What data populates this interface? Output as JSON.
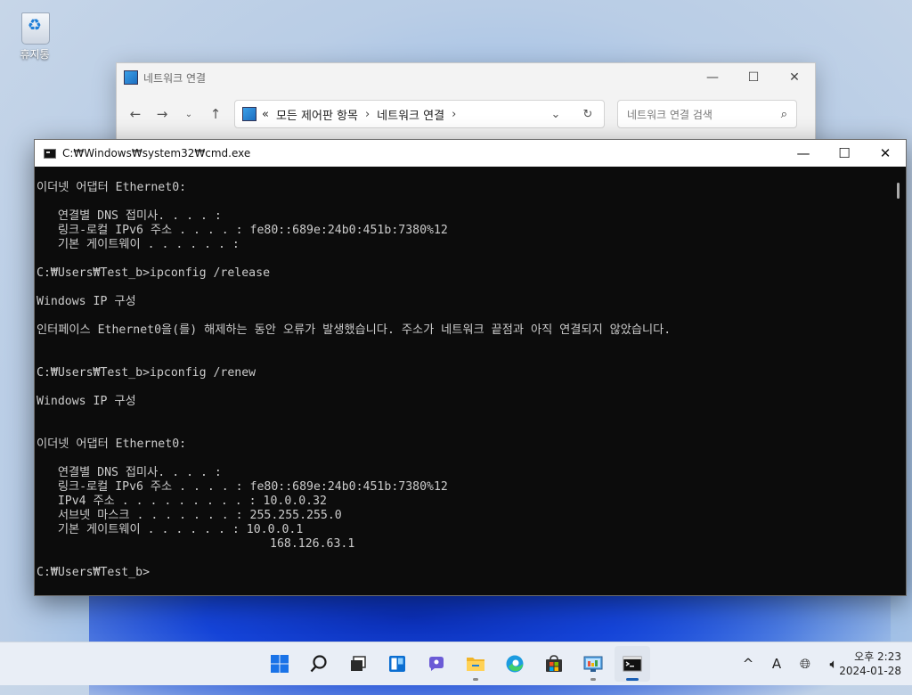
{
  "desktop": {
    "recycle_bin_label": "휴지통"
  },
  "explorer": {
    "title": "네트워크 연결",
    "breadcrumb_overflow": "«",
    "breadcrumb": [
      "모든 제어판 항목",
      "네트워크 연결"
    ],
    "search_placeholder": "네트워크 연결 검색"
  },
  "cmd": {
    "title": "C:₩Windows₩system32₩cmd.exe",
    "lines": [
      "",
      "이더넷 어댑터 Ethernet0:",
      "",
      "   연결별 DNS 접미사. . . . :",
      "   링크-로컬 IPv6 주소 . . . . : fe80::689e:24b0:451b:7380%12",
      "   기본 게이트웨이 . . . . . . :",
      "",
      "C:₩Users₩Test_b>ipconfig /release",
      "",
      "Windows IP 구성",
      "",
      "인터페이스 Ethernet0을(를) 해제하는 동안 오류가 발생했습니다. 주소가 네트워크 끝점과 아직 연결되지 않았습니다.",
      "",
      "",
      "C:₩Users₩Test_b>ipconfig /renew",
      "",
      "Windows IP 구성",
      "",
      "",
      "이더넷 어댑터 Ethernet0:",
      "",
      "   연결별 DNS 접미사. . . . :",
      "   링크-로컬 IPv6 주소 . . . . : fe80::689e:24b0:451b:7380%12",
      "   IPv4 주소 . . . . . . . . . : 10.0.0.32",
      "   서브넷 마스크 . . . . . . . : 255.255.255.0",
      "   기본 게이트웨이 . . . . . . : 10.0.0.1",
      "                                 168.126.63.1",
      "",
      "C:₩Users₩Test_b>"
    ]
  },
  "taskbar": {
    "apps": [
      "start-icon",
      "search-icon",
      "task-view-icon",
      "widgets-icon",
      "chat-icon",
      "file-explorer-icon",
      "edge-icon",
      "store-icon",
      "control-panel-icon",
      "terminal-icon"
    ],
    "ime_label": "A",
    "time": "오후 2:23",
    "date": "2024-01-28"
  }
}
